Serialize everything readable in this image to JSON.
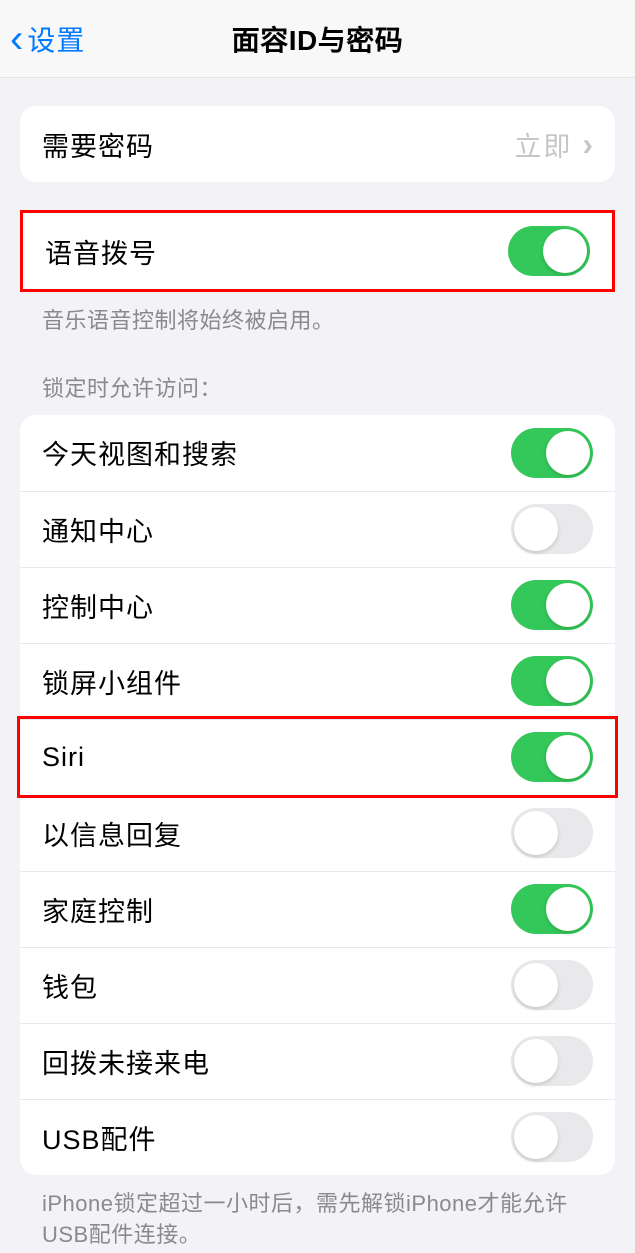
{
  "nav": {
    "back_label": "设置",
    "title": "面容ID与密码"
  },
  "passcode_row": {
    "label": "需要密码",
    "value": "立即"
  },
  "voice_dial": {
    "label": "语音拨号",
    "on": true,
    "footer": "音乐语音控制将始终被启用。"
  },
  "access_when_locked": {
    "header": "锁定时允许访问：",
    "items": [
      {
        "label": "今天视图和搜索",
        "on": true
      },
      {
        "label": "通知中心",
        "on": false
      },
      {
        "label": "控制中心",
        "on": true
      },
      {
        "label": "锁屏小组件",
        "on": true
      },
      {
        "label": "Siri",
        "on": true
      },
      {
        "label": "以信息回复",
        "on": false
      },
      {
        "label": "家庭控制",
        "on": true
      },
      {
        "label": "钱包",
        "on": false
      },
      {
        "label": "回拨未接来电",
        "on": false
      },
      {
        "label": "USB配件",
        "on": false
      }
    ],
    "footer": "iPhone锁定超过一小时后，需先解锁iPhone才能允许USB配件连接。"
  }
}
